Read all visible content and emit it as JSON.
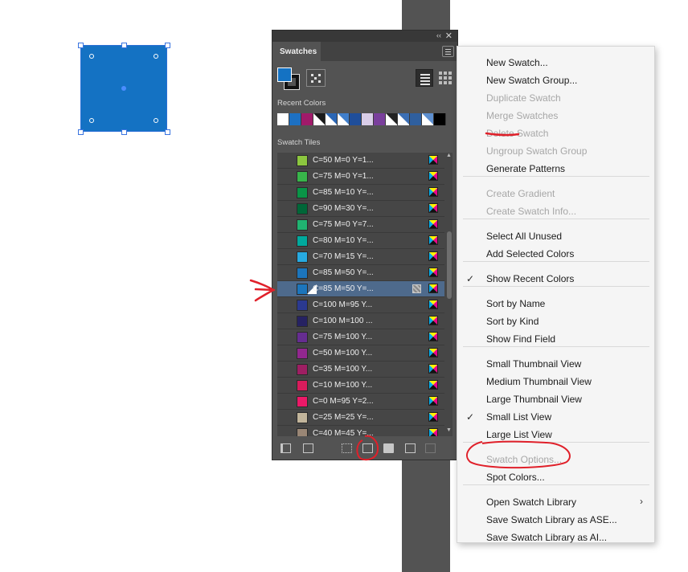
{
  "panel": {
    "tab_label": "Swatches",
    "collapse_glyph": "‹‹",
    "close_glyph": "✕",
    "recent_colors_label": "Recent Colors",
    "swatch_group_label": "Swatch Tiles",
    "recent_colors": [
      {
        "color": "#ffffff",
        "diag": true
      },
      {
        "color": "#1d70c2",
        "diag": false
      },
      {
        "color": "#a01a6a",
        "diag": false
      },
      {
        "color": "#1a1a1a",
        "diag": true
      },
      {
        "color": "#2a66b5",
        "diag": true
      },
      {
        "color": "#3f7ecb",
        "diag": true
      },
      {
        "color": "#1f4e9a",
        "diag": false
      },
      {
        "color": "#d9cde8",
        "diag": false
      },
      {
        "color": "#7a3f9c",
        "diag": false
      },
      {
        "color": "#222222",
        "diag": true
      },
      {
        "color": "#3b6fb5",
        "diag": true
      },
      {
        "color": "#2f5f9e",
        "diag": false
      },
      {
        "color": "#5d8fd0",
        "diag": true
      },
      {
        "color": "#000000",
        "diag": false
      }
    ],
    "swatches": [
      {
        "name": "C=50 M=0 Y=1...",
        "color": "#8cc63f",
        "selected": false
      },
      {
        "name": "C=75 M=0 Y=1...",
        "color": "#38b54a",
        "selected": false
      },
      {
        "name": "C=85 M=10 Y=...",
        "color": "#0a9447",
        "selected": false
      },
      {
        "name": "C=90 M=30 Y=...",
        "color": "#006738",
        "selected": false
      },
      {
        "name": "C=75 M=0 Y=7...",
        "color": "#20b371",
        "selected": false
      },
      {
        "name": "C=80 M=10 Y=...",
        "color": "#00a99d",
        "selected": false
      },
      {
        "name": "C=70 M=15 Y=...",
        "color": "#27aae1",
        "selected": false
      },
      {
        "name": "C=85 M=50 Y=...",
        "color": "#1c75bc",
        "selected": false
      },
      {
        "name": "C=85 M=50 Y=...",
        "color": "#1c75bc",
        "selected": true
      },
      {
        "name": "C=100 M=95 Y...",
        "color": "#2b3990",
        "selected": false
      },
      {
        "name": "C=100 M=100 ...",
        "color": "#262262",
        "selected": false
      },
      {
        "name": "C=75 M=100 Y...",
        "color": "#662d91",
        "selected": false
      },
      {
        "name": "C=50 M=100 Y...",
        "color": "#92278f",
        "selected": false
      },
      {
        "name": "C=35 M=100 Y...",
        "color": "#9e1f63",
        "selected": false
      },
      {
        "name": "C=10 M=100 Y...",
        "color": "#d91c5c",
        "selected": false
      },
      {
        "name": "C=0 M=95 Y=2...",
        "color": "#ec1968",
        "selected": false
      },
      {
        "name": "C=25 M=25 Y=...",
        "color": "#c2b59b",
        "selected": false
      },
      {
        "name": "C=40 M=45 Y=...",
        "color": "#998675",
        "selected": false
      }
    ]
  },
  "menu": {
    "items": [
      {
        "label": "New Swatch...",
        "disabled": false,
        "checked": false
      },
      {
        "label": "New Swatch Group...",
        "disabled": false,
        "checked": false
      },
      {
        "label": "Duplicate Swatch",
        "disabled": true,
        "checked": false
      },
      {
        "label": "Merge Swatches",
        "disabled": true,
        "checked": false
      },
      {
        "label": "Delete Swatch",
        "disabled": true,
        "checked": false
      },
      {
        "label": "Ungroup Swatch Group",
        "disabled": true,
        "checked": false
      },
      {
        "label": "Generate Patterns",
        "disabled": false,
        "checked": false
      },
      {
        "label": "Create Gradient",
        "disabled": true,
        "checked": false
      },
      {
        "label": "Create Swatch Info...",
        "disabled": true,
        "checked": false
      },
      {
        "label": "Select All Unused",
        "disabled": false,
        "checked": false
      },
      {
        "label": "Add Selected Colors",
        "disabled": false,
        "checked": false
      },
      {
        "label": "Show Recent Colors",
        "disabled": false,
        "checked": true
      },
      {
        "label": "Sort by Name",
        "disabled": false,
        "checked": false
      },
      {
        "label": "Sort by Kind",
        "disabled": false,
        "checked": false
      },
      {
        "label": "Show Find Field",
        "disabled": false,
        "checked": false
      },
      {
        "label": "Small Thumbnail View",
        "disabled": false,
        "checked": false
      },
      {
        "label": "Medium Thumbnail View",
        "disabled": false,
        "checked": false
      },
      {
        "label": "Large Thumbnail View",
        "disabled": false,
        "checked": false
      },
      {
        "label": "Small List View",
        "disabled": false,
        "checked": true
      },
      {
        "label": "Large List View",
        "disabled": false,
        "checked": false
      },
      {
        "label": "Swatch Options...",
        "disabled": true,
        "checked": false
      },
      {
        "label": "Spot Colors...",
        "disabled": false,
        "checked": false
      },
      {
        "label": "Open Swatch Library",
        "disabled": false,
        "checked": false,
        "submenu": true
      },
      {
        "label": "Save Swatch Library as ASE...",
        "disabled": false,
        "checked": false
      },
      {
        "label": "Save Swatch Library as AI...",
        "disabled": false,
        "checked": false
      }
    ],
    "checkmark": "✓",
    "submenu_arrow": "›"
  },
  "canvas": {
    "shape_color": "#1472c3",
    "background_strip_color": "#535353"
  },
  "colors": {
    "annotation_red": "#e0202a",
    "panel_bg": "#535353",
    "selection_row": "#4e6a8c"
  }
}
